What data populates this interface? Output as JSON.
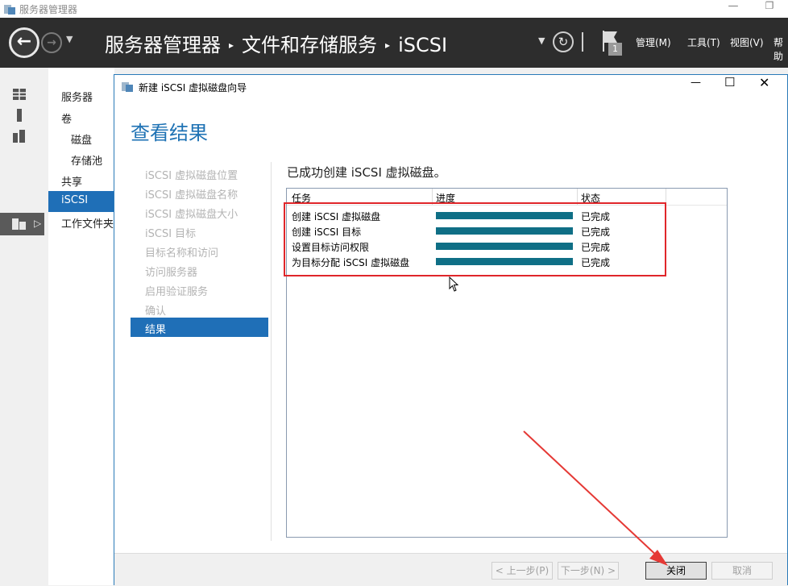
{
  "window": {
    "title": "服务器管理器",
    "minimize_glyph": "—",
    "restore_glyph": "❐"
  },
  "header": {
    "breadcrumb": [
      "服务器管理器",
      "文件和存储服务",
      "iSCSI"
    ],
    "breadcrumb_sep": "▸",
    "back_glyph": "←",
    "forward_glyph": "→",
    "dropdown_glyph": "▼",
    "refresh_glyph": "↻",
    "notification_count": "1",
    "menus": [
      "管理(M)",
      "工具(T)",
      "视图(V)",
      "帮助"
    ]
  },
  "sidebar": {
    "icons": [
      "dashboard-icon",
      "local-server-icon",
      "all-servers-icon",
      "file-storage-icon"
    ],
    "expand_glyph": "▷"
  },
  "nav": {
    "items": [
      "服务器",
      "卷",
      "磁盘",
      "存储池",
      "共享",
      "iSCSI",
      "工作文件夹"
    ]
  },
  "dialog": {
    "title": "新建 iSCSI 虚拟磁盘向导",
    "min_glyph": "—",
    "max_glyph": "☐",
    "close_glyph": "✕",
    "heading": "查看结果",
    "steps": [
      "iSCSI 虚拟磁盘位置",
      "iSCSI 虚拟磁盘名称",
      "iSCSI 虚拟磁盘大小",
      "iSCSI 目标",
      "目标名称和访问",
      "访问服务器",
      "启用验证服务",
      "确认",
      "结果"
    ],
    "active_step": 8,
    "success_message": "已成功创建 iSCSI 虚拟磁盘。",
    "columns": [
      "任务",
      "进度",
      "状态"
    ],
    "rows": [
      {
        "task": "创建 iSCSI 虚拟磁盘",
        "progress": 100,
        "status": "已完成"
      },
      {
        "task": "创建 iSCSI 目标",
        "progress": 100,
        "status": "已完成"
      },
      {
        "task": "设置目标访问权限",
        "progress": 100,
        "status": "已完成"
      },
      {
        "task": "为目标分配 iSCSI 虚拟磁盘",
        "progress": 100,
        "status": "已完成"
      }
    ],
    "buttons": {
      "prev": "< 上一步(P)",
      "next": "下一步(N) >",
      "close": "关闭",
      "cancel": "取消"
    }
  },
  "colors": {
    "accent": "#1f6fb7",
    "progress": "#0f6f86",
    "highlight": "#e0262a",
    "header_bg": "#2d2d2d"
  }
}
